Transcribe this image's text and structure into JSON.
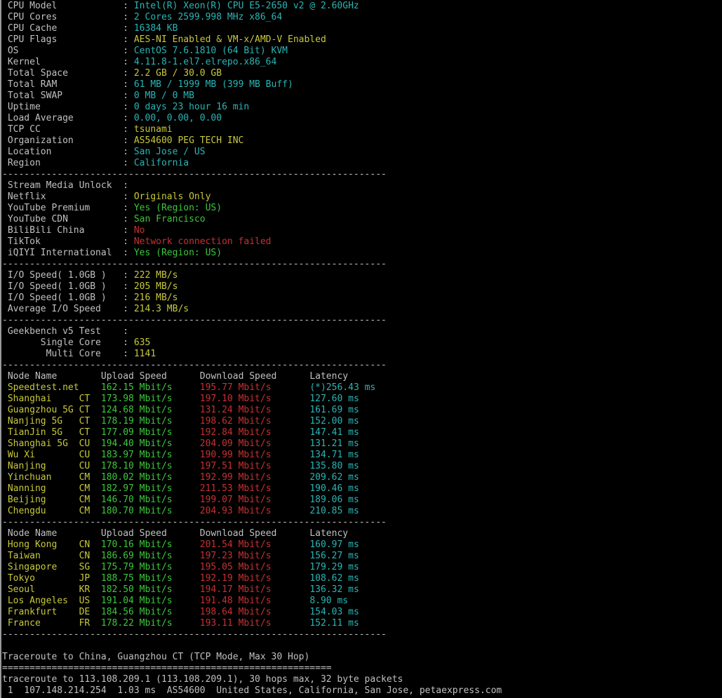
{
  "system": [
    {
      "label": " CPU Model            ",
      "sep": ": ",
      "value": "Intel(R) Xeon(R) CPU E5-2650 v2 @ 2.60GHz",
      "color": "c"
    },
    {
      "label": " CPU Cores            ",
      "sep": ": ",
      "value": "2 Cores 2599.998 MHz x86_64",
      "color": "c"
    },
    {
      "label": " CPU Cache            ",
      "sep": ": ",
      "value": "16384 KB",
      "color": "c"
    },
    {
      "label": " CPU Flags            ",
      "sep": ": ",
      "value": "AES-NI Enabled & VM-x/AMD-V Enabled",
      "color": "y"
    },
    {
      "label": " OS                   ",
      "sep": ": ",
      "value": "CentOS 7.6.1810 (64 Bit) KVM",
      "color": "c"
    },
    {
      "label": " Kernel               ",
      "sep": ": ",
      "value": "4.11.8-1.el7.elrepo.x86_64",
      "color": "c"
    },
    {
      "label": " Total Space          ",
      "sep": ": ",
      "value": "2.2 GB / 30.0 GB",
      "color": "y"
    },
    {
      "label": " Total RAM            ",
      "sep": ": ",
      "value": "61 MB / 1999 MB (399 MB Buff)",
      "color": "c"
    },
    {
      "label": " Total SWAP           ",
      "sep": ": ",
      "value": "0 MB / 0 MB",
      "color": "c"
    },
    {
      "label": " Uptime               ",
      "sep": ": ",
      "value": "0 days 23 hour 16 min",
      "color": "c"
    },
    {
      "label": " Load Average         ",
      "sep": ": ",
      "value": "0.00, 0.00, 0.00",
      "color": "c"
    },
    {
      "label": " TCP CC               ",
      "sep": ": ",
      "value": "tsunami",
      "color": "y"
    },
    {
      "label": " Organization         ",
      "sep": ": ",
      "value": "AS54600 PEG TECH INC",
      "color": "y"
    },
    {
      "label": " Location             ",
      "sep": ": ",
      "value": "San Jose / US",
      "color": "c"
    },
    {
      "label": " Region               ",
      "sep": ": ",
      "value": "California",
      "color": "c"
    }
  ],
  "divider": "----------------------------------------------------------------------",
  "double_divider": "============================================================",
  "stream": {
    "header_label": " Stream Media Unlock  ",
    "header_sep": ":",
    "items": [
      {
        "label": " Netflix              ",
        "sep": ": ",
        "value": "Originals Only",
        "color": "y"
      },
      {
        "label": " YouTube Premium      ",
        "sep": ": ",
        "value": "Yes (Region: US)",
        "color": "g"
      },
      {
        "label": " YouTube CDN          ",
        "sep": ": ",
        "value": "San Francisco",
        "color": "g"
      },
      {
        "label": " BiliBili China       ",
        "sep": ": ",
        "value": "No",
        "color": "r"
      },
      {
        "label": " TikTok               ",
        "sep": ": ",
        "value": "Network connection failed",
        "color": "r"
      },
      {
        "label": " iQIYI International  ",
        "sep": ": ",
        "value": "Yes (Region: US)",
        "color": "g"
      }
    ]
  },
  "io": [
    {
      "label": " I/O Speed( 1.0GB )   ",
      "sep": ": ",
      "value": "222 MB/s",
      "color": "y"
    },
    {
      "label": " I/O Speed( 1.0GB )   ",
      "sep": ": ",
      "value": "205 MB/s",
      "color": "y"
    },
    {
      "label": " I/O Speed( 1.0GB )   ",
      "sep": ": ",
      "value": "216 MB/s",
      "color": "y"
    },
    {
      "label": " Average I/O Speed    ",
      "sep": ": ",
      "value": "214.3 MB/s",
      "color": "y"
    }
  ],
  "geekbench": {
    "header_label": " Geekbench v5 Test    ",
    "header_sep": ":",
    "items": [
      {
        "label": "       Single Core    ",
        "sep": ": ",
        "value": "635",
        "color": "y"
      },
      {
        "label": "        Multi Core    ",
        "sep": ": ",
        "value": "1141",
        "color": "y"
      }
    ]
  },
  "speed_header": {
    "node": " Node Name        ",
    "upload": "Upload Speed      ",
    "download": "Download Speed      ",
    "latency": "Latency"
  },
  "speed_cn": [
    {
      "node": " Speedtest.net    ",
      "up": "162.15 Mbit/s     ",
      "down": "195.77 Mbit/s       ",
      "lat": "(*)256.43 ms"
    },
    {
      "node": " Shanghai     CT  ",
      "up": "173.98 Mbit/s     ",
      "down": "197.10 Mbit/s       ",
      "lat": "127.60 ms"
    },
    {
      "node": " Guangzhou 5G CT  ",
      "up": "124.68 Mbit/s     ",
      "down": "131.24 Mbit/s       ",
      "lat": "161.69 ms"
    },
    {
      "node": " Nanjing 5G   CT  ",
      "up": "178.19 Mbit/s     ",
      "down": "198.62 Mbit/s       ",
      "lat": "152.00 ms"
    },
    {
      "node": " TianJin 5G   CT  ",
      "up": "177.09 Mbit/s     ",
      "down": "192.84 Mbit/s       ",
      "lat": "147.41 ms"
    },
    {
      "node": " Shanghai 5G  CU  ",
      "up": "194.40 Mbit/s     ",
      "down": "204.09 Mbit/s       ",
      "lat": "131.21 ms"
    },
    {
      "node": " Wu Xi        CU  ",
      "up": "183.97 Mbit/s     ",
      "down": "190.99 Mbit/s       ",
      "lat": "134.71 ms"
    },
    {
      "node": " Nanjing      CU  ",
      "up": "178.10 Mbit/s     ",
      "down": "197.51 Mbit/s       ",
      "lat": "135.80 ms"
    },
    {
      "node": " Yinchuan     CM  ",
      "up": "180.02 Mbit/s     ",
      "down": "192.99 Mbit/s       ",
      "lat": "209.62 ms"
    },
    {
      "node": " Nanning      CM  ",
      "up": "182.97 Mbit/s     ",
      "down": "211.53 Mbit/s       ",
      "lat": "190.46 ms"
    },
    {
      "node": " Beijing      CM  ",
      "up": "146.70 Mbit/s     ",
      "down": "199.07 Mbit/s       ",
      "lat": "189.06 ms"
    },
    {
      "node": " Chengdu      CM  ",
      "up": "180.70 Mbit/s     ",
      "down": "204.93 Mbit/s       ",
      "lat": "210.85 ms"
    }
  ],
  "speed_intl": [
    {
      "node": " Hong Kong    CN  ",
      "up": "170.16 Mbit/s     ",
      "down": "201.54 Mbit/s       ",
      "lat": "160.97 ms"
    },
    {
      "node": " Taiwan       CN  ",
      "up": "186.69 Mbit/s     ",
      "down": "197.23 Mbit/s       ",
      "lat": "156.27 ms"
    },
    {
      "node": " Singapore    SG  ",
      "up": "175.79 Mbit/s     ",
      "down": "195.05 Mbit/s       ",
      "lat": "179.29 ms"
    },
    {
      "node": " Tokyo        JP  ",
      "up": "188.75 Mbit/s     ",
      "down": "192.19 Mbit/s       ",
      "lat": "108.62 ms"
    },
    {
      "node": " Seoul        KR  ",
      "up": "182.50 Mbit/s     ",
      "down": "194.17 Mbit/s       ",
      "lat": "136.32 ms"
    },
    {
      "node": " Los Angeles  US  ",
      "up": "191.04 Mbit/s     ",
      "down": "191.48 Mbit/s       ",
      "lat": "8.90 ms"
    },
    {
      "node": " Frankfurt    DE  ",
      "up": "184.56 Mbit/s     ",
      "down": "198.64 Mbit/s       ",
      "lat": "154.03 ms"
    },
    {
      "node": " France       FR  ",
      "up": "178.22 Mbit/s     ",
      "down": "193.11 Mbit/s       ",
      "lat": "152.11 ms"
    }
  ],
  "traceroute": {
    "title": "Traceroute to China, Guangzhou CT (TCP Mode, Max 30 Hop)",
    "header": "traceroute to 113.108.209.1 (113.108.209.1), 30 hops max, 32 byte packets",
    "hop1": " 1  107.148.214.254  1.03 ms  AS54600  United States, California, San Jose, petaexpress.com"
  },
  "colors": {
    "background": "#000000",
    "text": "#c0c0c0",
    "cyan": "#2bb5b5",
    "yellow": "#c8c83c",
    "green": "#3cc83c",
    "red": "#c83030"
  }
}
